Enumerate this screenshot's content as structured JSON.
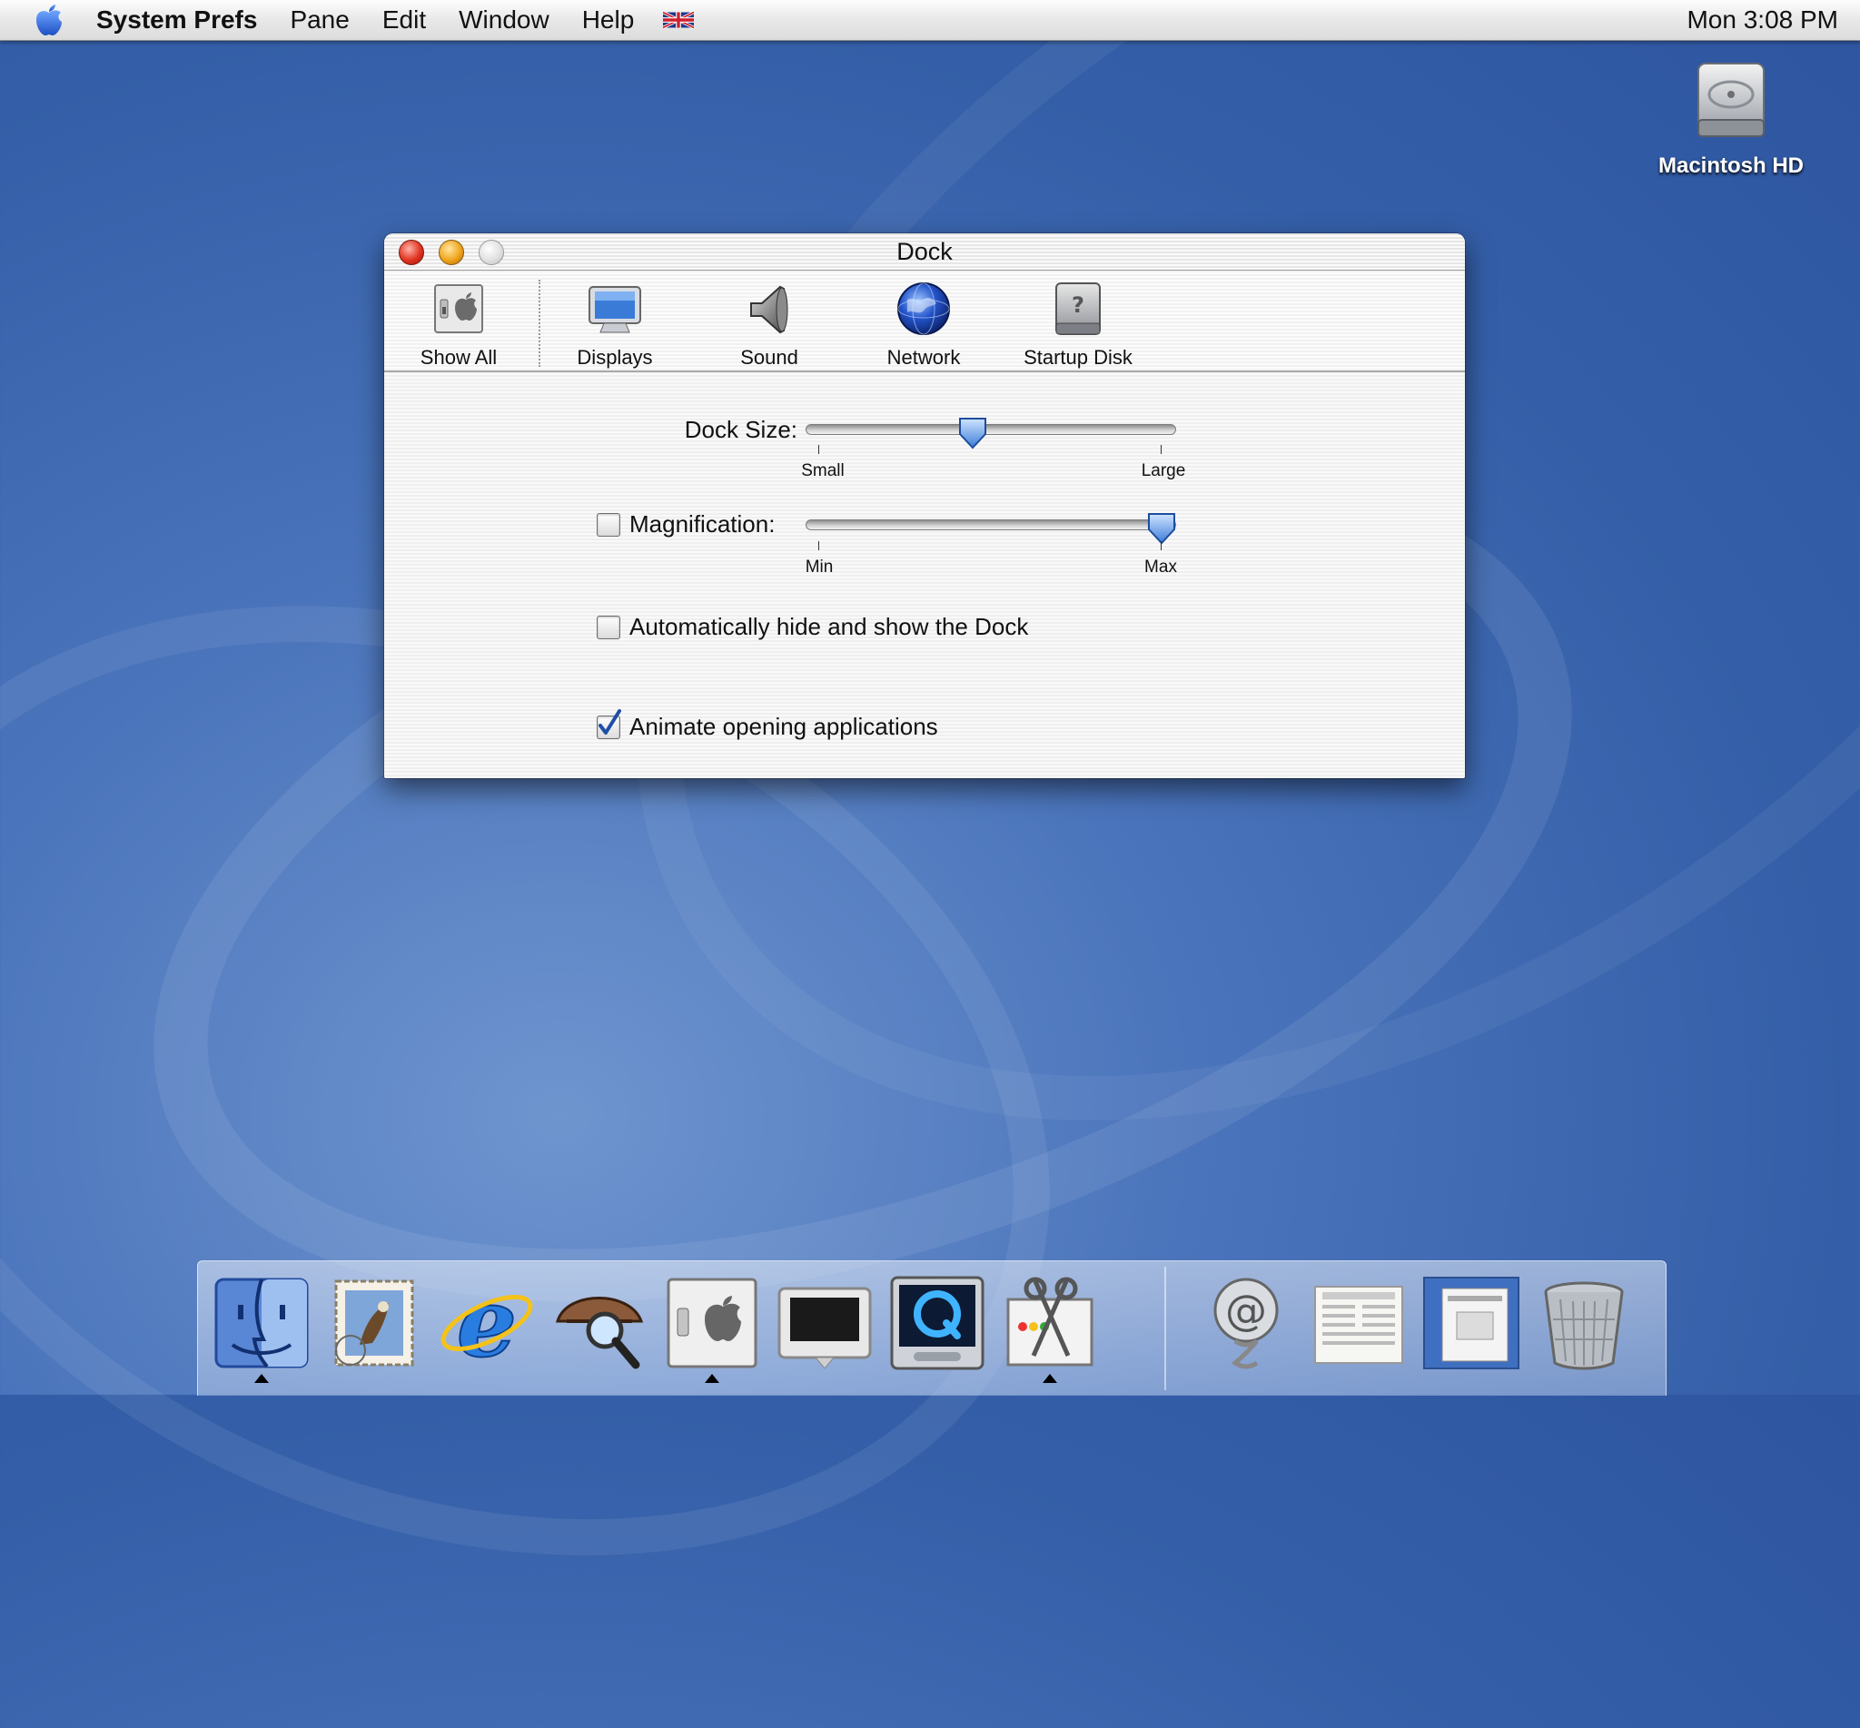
{
  "menubar": {
    "app_name": "System Prefs",
    "items": [
      "Pane",
      "Edit",
      "Window",
      "Help"
    ],
    "clock": "Mon 3:08 PM"
  },
  "desktop": {
    "icons": [
      {
        "label": "Macintosh HD",
        "icon": "hard-drive-icon"
      }
    ]
  },
  "window": {
    "title": "Dock",
    "toolbar": [
      {
        "label": "Show All",
        "icon": "show-all-icon"
      },
      {
        "label": "Displays",
        "icon": "displays-icon"
      },
      {
        "label": "Sound",
        "icon": "sound-icon"
      },
      {
        "label": "Network",
        "icon": "network-icon"
      },
      {
        "label": "Startup Disk",
        "icon": "startup-disk-icon"
      }
    ],
    "dock_size": {
      "label": "Dock Size:",
      "min_label": "Small",
      "max_label": "Large",
      "value": 0.45
    },
    "magnification": {
      "label": "Magnification:",
      "checked": false,
      "min_label": "Min",
      "max_label": "Max",
      "value": 1.0
    },
    "autohide": {
      "label": "Automatically hide and show the Dock",
      "checked": false
    },
    "animate": {
      "label": "Animate opening applications",
      "checked": true
    }
  },
  "dock": {
    "apps": [
      {
        "name": "finder-icon",
        "running": true
      },
      {
        "name": "mail-icon",
        "running": false
      },
      {
        "name": "internet-explorer-icon",
        "running": false
      },
      {
        "name": "sherlock-icon",
        "running": false
      },
      {
        "name": "system-preferences-icon",
        "running": true
      },
      {
        "name": "monitor-icon",
        "running": false
      },
      {
        "name": "quicktime-icon",
        "running": false
      },
      {
        "name": "grab-scissors-icon",
        "running": true
      }
    ],
    "others": [
      {
        "name": "internet-at-icon"
      },
      {
        "name": "document-icon"
      },
      {
        "name": "minimized-window-icon"
      },
      {
        "name": "trash-icon"
      }
    ]
  },
  "colors": {
    "desktop_blue": "#345fa8",
    "close_red": "#e0331f",
    "minimize_amber": "#f0a51c",
    "check_blue": "#2b5bb8"
  }
}
